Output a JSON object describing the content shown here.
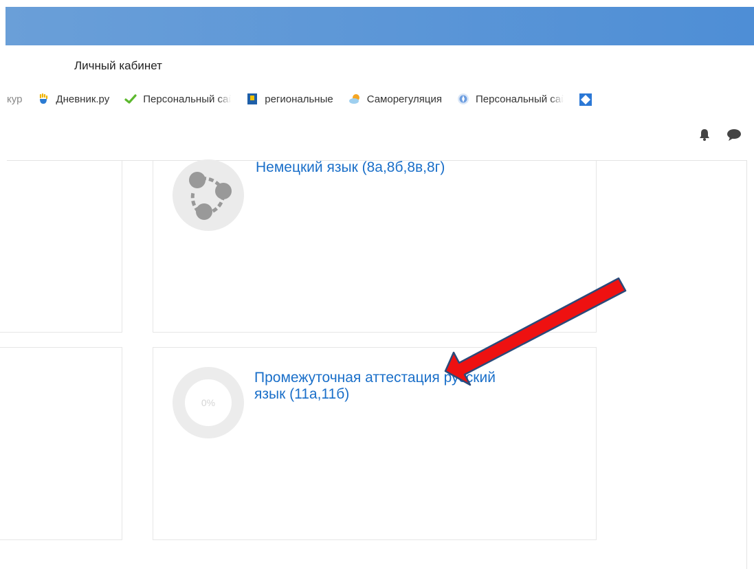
{
  "window": {
    "title": "Личный кабинет"
  },
  "bookmarks": [
    {
      "label": "кур",
      "icon": "page-icon"
    },
    {
      "label": "Дневник.ру",
      "icon": "hand-icon"
    },
    {
      "label": "Персональный сай",
      "icon": "checkmark-icon"
    },
    {
      "label": "региональные",
      "icon": "bookmark-blue-icon"
    },
    {
      "label": "Саморегуляция",
      "icon": "weather-icon"
    },
    {
      "label": "Персональный сай",
      "icon": "compass-icon"
    }
  ],
  "toolbar": {
    "notifications_icon": "bell-icon",
    "messages_icon": "chat-bubble-icon"
  },
  "courses": [
    {
      "title": "Немецкий язык (8а,8б,8в,8г)",
      "icon": "course-share-icon"
    },
    {
      "title_line1": "Промежуточная аттестация русский",
      "title_line2": "язык (11а,11б)",
      "progress_label": "0%",
      "progress": 0
    }
  ],
  "colors": {
    "titlebar": "#5a95d8",
    "link": "#1a6fc9",
    "arrow": "#ee1111"
  }
}
